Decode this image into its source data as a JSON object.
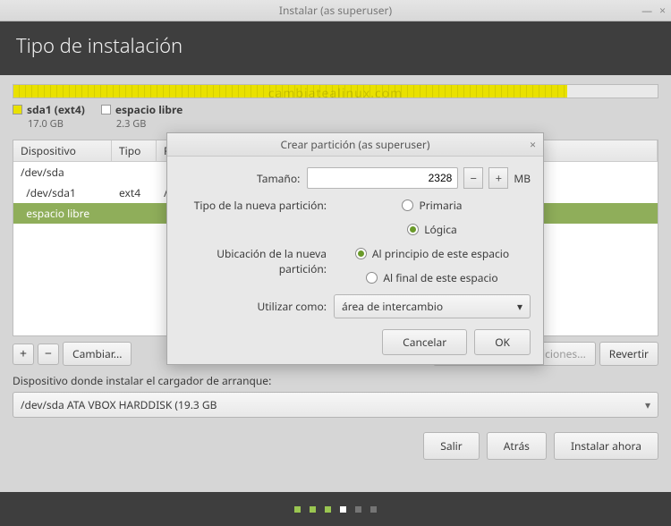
{
  "window": {
    "title": "Instalar (as superuser)"
  },
  "header": {
    "title": "Tipo de instalación"
  },
  "watermark": "cambiatealinux.com",
  "legend": {
    "p1": {
      "label": "sda1 (ext4)",
      "size": "17.0 GB"
    },
    "free": {
      "label": "espacio libre",
      "size": "2.3 GB"
    }
  },
  "table": {
    "headers": {
      "device": "Dispositivo",
      "type": "Tipo",
      "mount": "Punto de"
    },
    "rows": [
      {
        "device": "/dev/sda",
        "type": "",
        "mount": ""
      },
      {
        "device": "  /dev/sda1",
        "type": "ext4",
        "mount": "/"
      },
      {
        "device": "  espacio libre",
        "type": "",
        "mount": ""
      }
    ]
  },
  "toolbar": {
    "add": "+",
    "remove": "−",
    "change": "Cambiar...",
    "new_table": "Nueva tabla de particiones...",
    "revert": "Revertir"
  },
  "bootloader": {
    "label": "Dispositivo donde instalar el cargador de arranque:",
    "value": "/dev/sda   ATA VBOX HARDDISK (19.3 GB"
  },
  "actions": {
    "quit": "Salir",
    "back": "Atrás",
    "install": "Instalar ahora"
  },
  "dialog": {
    "title": "Crear partición (as superuser)",
    "size_label": "Tamaño:",
    "size_value": "2328",
    "size_unit": "MB",
    "type_label": "Tipo de la nueva partición:",
    "type_primary": "Primaria",
    "type_logical": "Lógica",
    "loc_label": "Ubicación de la nueva partición:",
    "loc_begin": "Al principio de este espacio",
    "loc_end": "Al final de este espacio",
    "use_label": "Utilizar como:",
    "use_value": "área de intercambio",
    "cancel": "Cancelar",
    "ok": "OK"
  }
}
